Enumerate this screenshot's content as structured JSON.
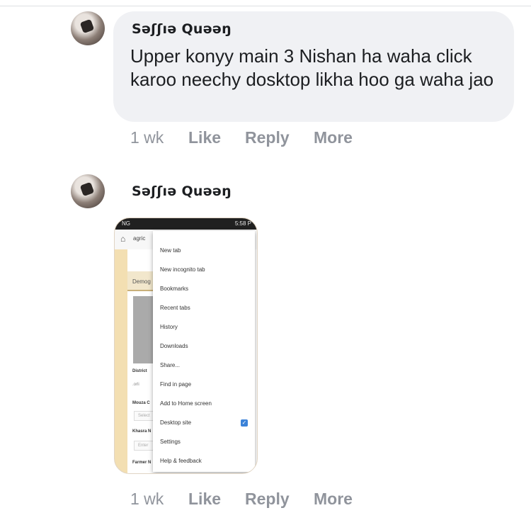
{
  "comments": [
    {
      "author": "Səʃʃıə Quəəŋ",
      "text": "Upper konyy main 3 Nishan ha waha click karoo neechy dosktop likha hoo ga waha jao",
      "time": "1 wk",
      "actions": {
        "like": "Like",
        "reply": "Reply",
        "more": "More"
      }
    },
    {
      "author": "Səʃʃıə Quəəŋ",
      "time": "1 wk",
      "actions": {
        "like": "Like",
        "reply": "Reply",
        "more": "More"
      },
      "attachment": {
        "status_bar": {
          "carrier": "NG",
          "clock": "5:58 P"
        },
        "url_text": "agric",
        "tab_label": "Demog",
        "page_labels": [
          "District",
          "Mouza C",
          "Khasra N",
          "Farmer N"
        ],
        "page_small": [
          ".orli",
          "Select",
          "Enter"
        ],
        "menu_items": [
          "New tab",
          "New incognito tab",
          "Bookmarks",
          "Recent tabs",
          "History",
          "Downloads",
          "Share...",
          "Find in page",
          "Add to Home screen",
          "Desktop site",
          "Settings",
          "Help & feedback"
        ],
        "desktop_site_checked": true
      }
    }
  ],
  "colors": {
    "bubble": "#f0f1f4",
    "action_text": "#90949c",
    "author_text": "#1c1e21",
    "check_blue": "#3b82d8"
  }
}
